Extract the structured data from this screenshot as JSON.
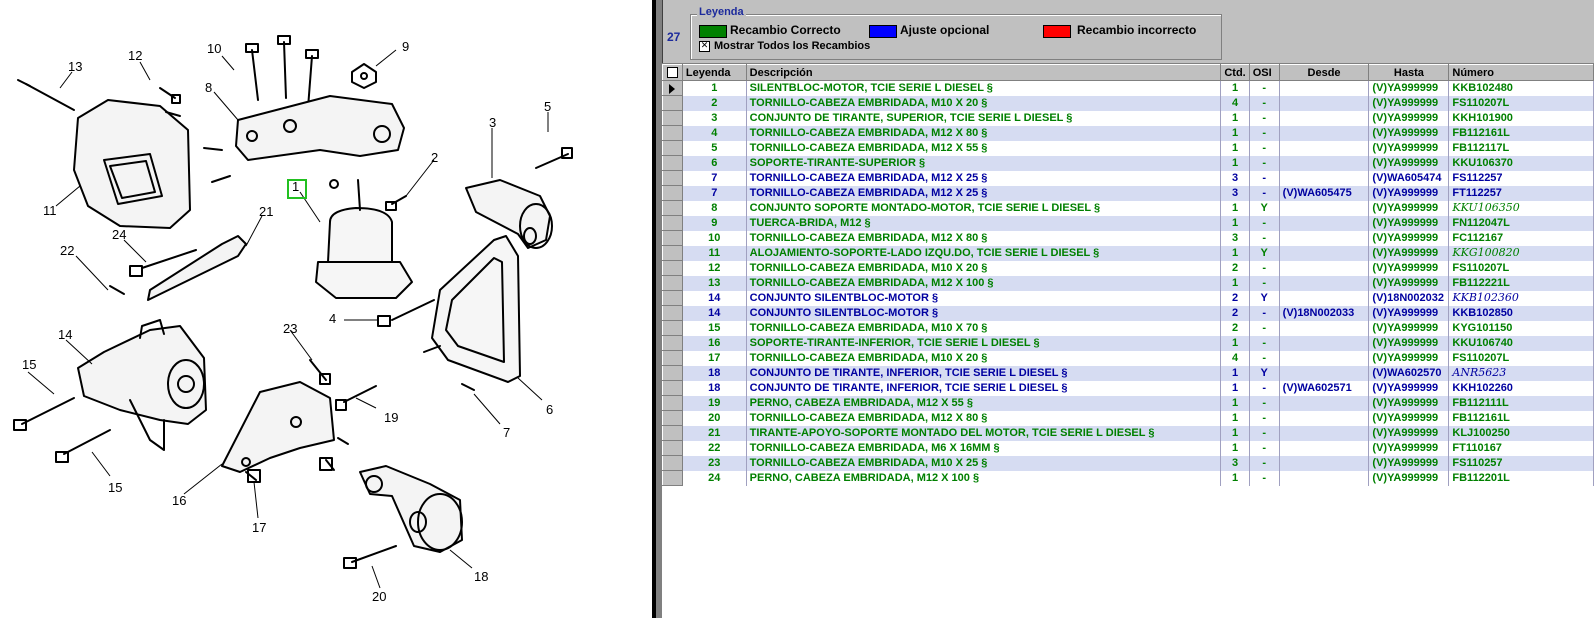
{
  "callouts": [
    "1",
    "2",
    "3",
    "4",
    "5",
    "6",
    "7",
    "8",
    "9",
    "10",
    "11",
    "12",
    "13",
    "14",
    "15",
    "15",
    "16",
    "17",
    "18",
    "19",
    "20",
    "21",
    "22",
    "23",
    "24"
  ],
  "panel": {
    "page_number": "27",
    "legend": {
      "title": "Leyenda",
      "items": [
        {
          "label": "Recambio Correcto",
          "color": "#008000"
        },
        {
          "label": "Ajuste opcional",
          "color": "#0000ff"
        },
        {
          "label": "Recambio incorrecto",
          "color": "#ff0000"
        }
      ],
      "show_all_label": "Mostrar Todos los Recambios",
      "show_all_checked": "✕"
    },
    "table": {
      "columns": [
        "Leyenda",
        "Descripción",
        "Ctd.",
        "OSI",
        "Desde",
        "Hasta",
        "Número"
      ],
      "rows": [
        {
          "leyenda": "1",
          "desc": "SILENTBLOC-MOTOR, TCIE SERIE L DIESEL §",
          "ctd": "1",
          "osi": "-",
          "desde": "",
          "hasta": "(V)YA999999",
          "numero": "KKB102480",
          "color": "#008000",
          "num_italic": false,
          "selected": true
        },
        {
          "leyenda": "2",
          "desc": "TORNILLO-CABEZA EMBRIDADA, M10 X 20 §",
          "ctd": "4",
          "osi": "-",
          "desde": "",
          "hasta": "(V)YA999999",
          "numero": "FS110207L",
          "color": "#008000",
          "num_italic": false
        },
        {
          "leyenda": "3",
          "desc": "CONJUNTO DE TIRANTE, SUPERIOR, TCIE SERIE L DIESEL §",
          "ctd": "1",
          "osi": "-",
          "desde": "",
          "hasta": "(V)YA999999",
          "numero": "KKH101900",
          "color": "#008000",
          "num_italic": false
        },
        {
          "leyenda": "4",
          "desc": "TORNILLO-CABEZA EMBRIDADA, M12 X 80 §",
          "ctd": "1",
          "osi": "-",
          "desde": "",
          "hasta": "(V)YA999999",
          "numero": "FB112161L",
          "color": "#008000",
          "num_italic": false
        },
        {
          "leyenda": "5",
          "desc": "TORNILLO-CABEZA EMBRIDADA, M12 X 55 §",
          "ctd": "1",
          "osi": "-",
          "desde": "",
          "hasta": "(V)YA999999",
          "numero": "FB112117L",
          "color": "#008000",
          "num_italic": false
        },
        {
          "leyenda": "6",
          "desc": "SOPORTE-TIRANTE-SUPERIOR §",
          "ctd": "1",
          "osi": "-",
          "desde": "",
          "hasta": "(V)YA999999",
          "numero": "KKU106370",
          "color": "#008000",
          "num_italic": false
        },
        {
          "leyenda": "7",
          "desc": "TORNILLO-CABEZA EMBRIDADA, M12 X 25 §",
          "ctd": "3",
          "osi": "-",
          "desde": "",
          "hasta": "(V)WA605474",
          "numero": "FS112257",
          "color": "#0000a0",
          "num_italic": false
        },
        {
          "leyenda": "7",
          "desc": "TORNILLO-CABEZA EMBRIDADA, M12 X 25 §",
          "ctd": "3",
          "osi": "-",
          "desde": "(V)WA605475",
          "hasta": "(V)YA999999",
          "numero": "FT112257",
          "color": "#0000a0",
          "num_italic": false
        },
        {
          "leyenda": "8",
          "desc": "CONJUNTO SOPORTE MONTADO-MOTOR, TCIE SERIE L DIESEL §",
          "ctd": "1",
          "osi": "Y",
          "desde": "",
          "hasta": "(V)YA999999",
          "numero": "KKU106350",
          "color": "#008000",
          "num_italic": true
        },
        {
          "leyenda": "9",
          "desc": "TUERCA-BRIDA, M12 §",
          "ctd": "1",
          "osi": "-",
          "desde": "",
          "hasta": "(V)YA999999",
          "numero": "FN112047L",
          "color": "#008000",
          "num_italic": false
        },
        {
          "leyenda": "10",
          "desc": "TORNILLO-CABEZA EMBRIDADA, M12 X 80 §",
          "ctd": "3",
          "osi": "-",
          "desde": "",
          "hasta": "(V)YA999999",
          "numero": "FC112167",
          "color": "#008000",
          "num_italic": false
        },
        {
          "leyenda": "11",
          "desc": "ALOJAMIENTO-SOPORTE-LADO IZQU.DO, TCIE SERIE L DIESEL §",
          "ctd": "1",
          "osi": "Y",
          "desde": "",
          "hasta": "(V)YA999999",
          "numero": "KKG100820",
          "color": "#008000",
          "num_italic": true
        },
        {
          "leyenda": "12",
          "desc": "TORNILLO-CABEZA EMBRIDADA, M10 X 20 §",
          "ctd": "2",
          "osi": "-",
          "desde": "",
          "hasta": "(V)YA999999",
          "numero": "FS110207L",
          "color": "#008000",
          "num_italic": false
        },
        {
          "leyenda": "13",
          "desc": "TORNILLO-CABEZA EMBRIDADA, M12 X 100 §",
          "ctd": "1",
          "osi": "-",
          "desde": "",
          "hasta": "(V)YA999999",
          "numero": "FB112221L",
          "color": "#008000",
          "num_italic": false
        },
        {
          "leyenda": "14",
          "desc": "CONJUNTO SILENTBLOC-MOTOR §",
          "ctd": "2",
          "osi": "Y",
          "desde": "",
          "hasta": "(V)18N002032",
          "numero": "KKB102360",
          "color": "#0000a0",
          "num_italic": true
        },
        {
          "leyenda": "14",
          "desc": "CONJUNTO SILENTBLOC-MOTOR §",
          "ctd": "2",
          "osi": "-",
          "desde": "(V)18N002033",
          "hasta": "(V)YA999999",
          "numero": "KKB102850",
          "color": "#0000a0",
          "num_italic": false
        },
        {
          "leyenda": "15",
          "desc": "TORNILLO-CABEZA EMBRIDADA, M10 X 70 §",
          "ctd": "2",
          "osi": "-",
          "desde": "",
          "hasta": "(V)YA999999",
          "numero": "KYG101150",
          "color": "#008000",
          "num_italic": false
        },
        {
          "leyenda": "16",
          "desc": "SOPORTE-TIRANTE-INFERIOR, TCIE SERIE L DIESEL §",
          "ctd": "1",
          "osi": "-",
          "desde": "",
          "hasta": "(V)YA999999",
          "numero": "KKU106740",
          "color": "#008000",
          "num_italic": false
        },
        {
          "leyenda": "17",
          "desc": "TORNILLO-CABEZA EMBRIDADA, M10 X 20 §",
          "ctd": "4",
          "osi": "-",
          "desde": "",
          "hasta": "(V)YA999999",
          "numero": "FS110207L",
          "color": "#008000",
          "num_italic": false
        },
        {
          "leyenda": "18",
          "desc": "CONJUNTO DE TIRANTE, INFERIOR, TCIE SERIE L DIESEL §",
          "ctd": "1",
          "osi": "Y",
          "desde": "",
          "hasta": "(V)WA602570",
          "numero": "ANR5623",
          "color": "#0000a0",
          "num_italic": true
        },
        {
          "leyenda": "18",
          "desc": "CONJUNTO DE TIRANTE, INFERIOR, TCIE SERIE L DIESEL §",
          "ctd": "1",
          "osi": "-",
          "desde": "(V)WA602571",
          "hasta": "(V)YA999999",
          "numero": "KKH102260",
          "color": "#0000a0",
          "num_italic": false
        },
        {
          "leyenda": "19",
          "desc": "PERNO, CABEZA EMBRIDADA, M12 X 55 §",
          "ctd": "1",
          "osi": "-",
          "desde": "",
          "hasta": "(V)YA999999",
          "numero": "FB112111L",
          "color": "#008000",
          "num_italic": false
        },
        {
          "leyenda": "20",
          "desc": "TORNILLO-CABEZA EMBRIDADA, M12 X 80 §",
          "ctd": "1",
          "osi": "-",
          "desde": "",
          "hasta": "(V)YA999999",
          "numero": "FB112161L",
          "color": "#008000",
          "num_italic": false
        },
        {
          "leyenda": "21",
          "desc": "TIRANTE-APOYO-SOPORTE MONTADO DEL MOTOR, TCIE SERIE L DIESEL §",
          "ctd": "1",
          "osi": "-",
          "desde": "",
          "hasta": "(V)YA999999",
          "numero": "KLJ100250",
          "color": "#008000",
          "num_italic": false
        },
        {
          "leyenda": "22",
          "desc": "TORNILLO-CABEZA EMBRIDADA, M6 X 16MM §",
          "ctd": "1",
          "osi": "-",
          "desde": "",
          "hasta": "(V)YA999999",
          "numero": "FT110167",
          "color": "#008000",
          "num_italic": false
        },
        {
          "leyenda": "23",
          "desc": "TORNILLO-CABEZA EMBRIDADA, M10 X 25 §",
          "ctd": "3",
          "osi": "-",
          "desde": "",
          "hasta": "(V)YA999999",
          "numero": "FS110257",
          "color": "#008000",
          "num_italic": false
        },
        {
          "leyenda": "24",
          "desc": "PERNO, CABEZA EMBRIDADA, M12 X 100 §",
          "ctd": "1",
          "osi": "-",
          "desde": "",
          "hasta": "(V)YA999999",
          "numero": "FB112201L",
          "color": "#008000",
          "num_italic": false
        }
      ]
    }
  }
}
